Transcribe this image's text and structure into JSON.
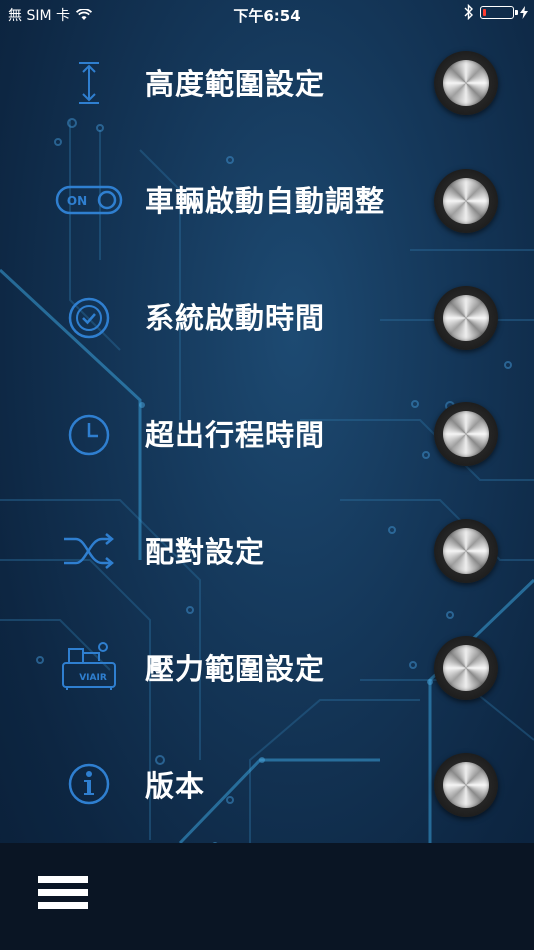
{
  "status_bar": {
    "carrier": "無 SIM 卡",
    "time": "下午6:54"
  },
  "menu": {
    "items": [
      {
        "label": "高度範圍設定",
        "icon": "height-arrow-icon"
      },
      {
        "label": "車輛啟動自動調整",
        "icon": "on-toggle-icon",
        "icon_text": "ON"
      },
      {
        "label": "系統啟動時間",
        "icon": "check-circle-icon"
      },
      {
        "label": "超出行程時間",
        "icon": "clock-icon"
      },
      {
        "label": "配對設定",
        "icon": "shuffle-icon"
      },
      {
        "label": "壓力範圍設定",
        "icon": "air-compressor-icon",
        "icon_text": "VIAIR"
      },
      {
        "label": "版本",
        "icon": "info-icon"
      }
    ]
  },
  "colors": {
    "icon_blue": "#2f7fd0",
    "background": "#143658",
    "bottom_bar": "#0a1524"
  }
}
